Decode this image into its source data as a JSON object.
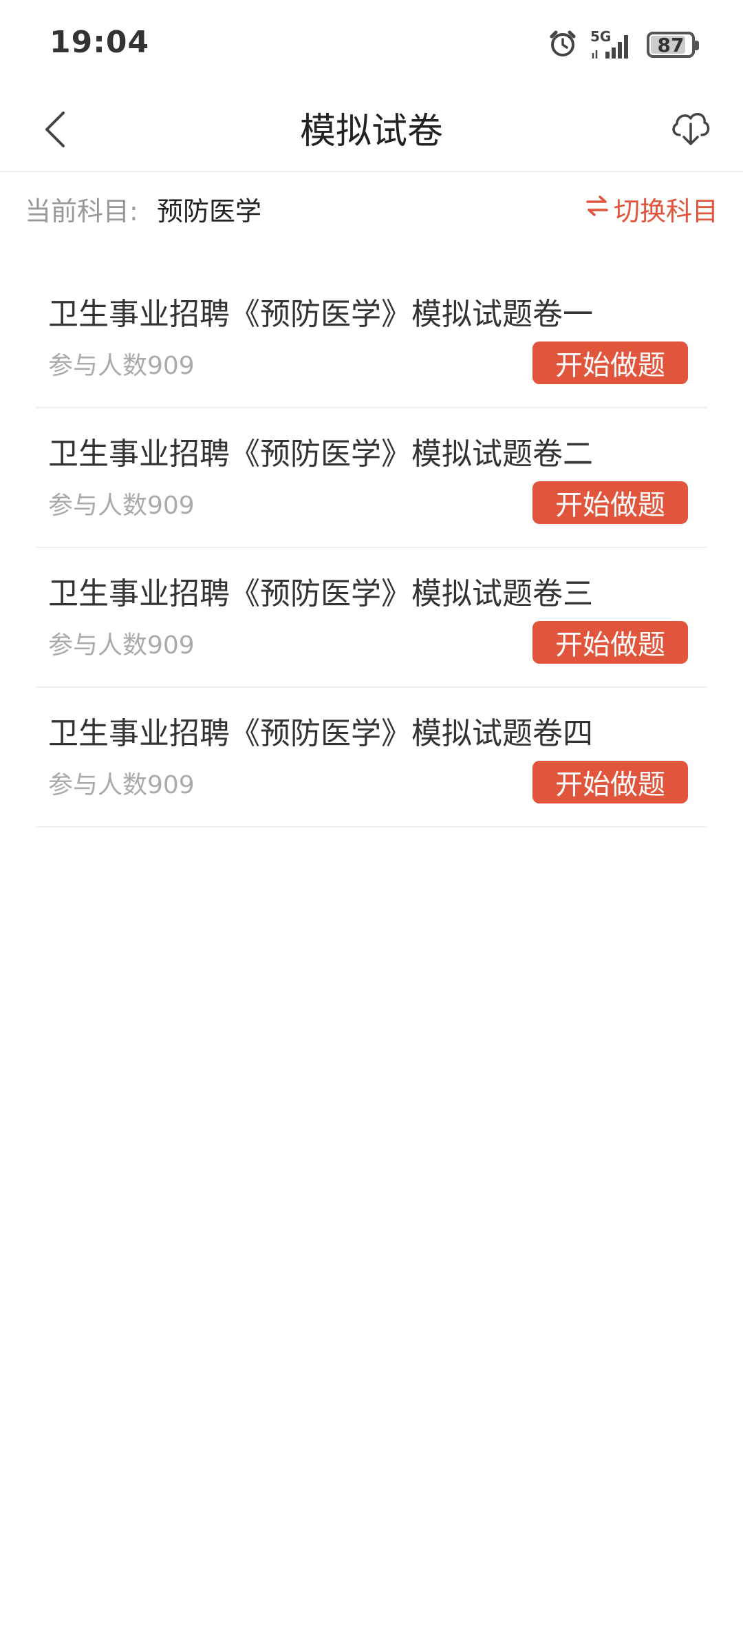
{
  "status": {
    "time": "19:04",
    "network": "5G",
    "battery": "87",
    "battery_level": 0.87
  },
  "nav": {
    "title": "模拟试卷",
    "back_icon": "chevron-left-icon",
    "download_icon": "cloud-download-icon"
  },
  "subject": {
    "label": "当前科目:",
    "value": "预防医学",
    "switch_icon": "swap-arrows-icon",
    "switch_label": "切换科目"
  },
  "papers": [
    {
      "title": "卫生事业招聘《预防医学》模拟试题卷一",
      "count": "参与人数909",
      "button": "开始做题"
    },
    {
      "title": "卫生事业招聘《预防医学》模拟试题卷二",
      "count": "参与人数909",
      "button": "开始做题"
    },
    {
      "title": "卫生事业招聘《预防医学》模拟试题卷三",
      "count": "参与人数909",
      "button": "开始做题"
    },
    {
      "title": "卫生事业招聘《预防医学》模拟试题卷四",
      "count": "参与人数909",
      "button": "开始做题"
    }
  ],
  "colors": {
    "accent": "#e0553b"
  }
}
